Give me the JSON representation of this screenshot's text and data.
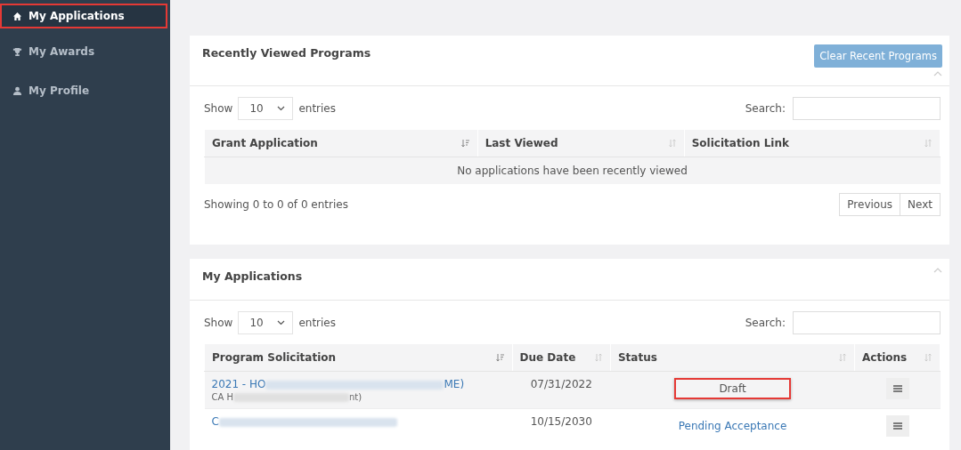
{
  "sidebar": {
    "items": [
      {
        "label": "My Applications",
        "selected": true,
        "highlighted": true
      },
      {
        "label": "My Awards",
        "selected": false,
        "highlighted": false
      },
      {
        "label": "My Profile",
        "selected": false,
        "highlighted": false
      }
    ]
  },
  "recent": {
    "title": "Clear Recent Programs",
    "heading": "Recently Viewed Programs",
    "show_label": "Show",
    "page_size": "10",
    "entries_label": "entries",
    "search_label": "Search:",
    "columns": [
      {
        "label": "Grant Application",
        "sorted": true
      },
      {
        "label": "Last Viewed",
        "sorted": false
      },
      {
        "label": "Solicitation Link",
        "sorted": false
      }
    ],
    "empty_message": "No applications have been recently viewed",
    "info": "Showing 0 to 0 of 0 entries",
    "pager": [
      "Previous",
      "Next"
    ]
  },
  "applications": {
    "heading": "My Applications",
    "show_label": "Show",
    "page_size": "10",
    "entries_label": "entries",
    "search_label": "Search:",
    "columns": [
      {
        "label": "Program Solicitation",
        "sorted": true
      },
      {
        "label": "Due Date",
        "sorted": false
      },
      {
        "label": "Status",
        "sorted": false
      },
      {
        "label": "Actions",
        "sorted": false
      }
    ],
    "rows": [
      {
        "title_start": "2021 - HO",
        "title_end": "ME)",
        "subtitle_start": "CA H",
        "subtitle_end": "nt)",
        "due_date": "07/31/2022",
        "status": "Draft",
        "kind": "plain",
        "highlighted": true
      },
      {
        "title_start": "C",
        "due_date": "10/15/2030",
        "status": "Pending Acceptance",
        "kind": "link",
        "highlighted": false
      }
    ]
  }
}
